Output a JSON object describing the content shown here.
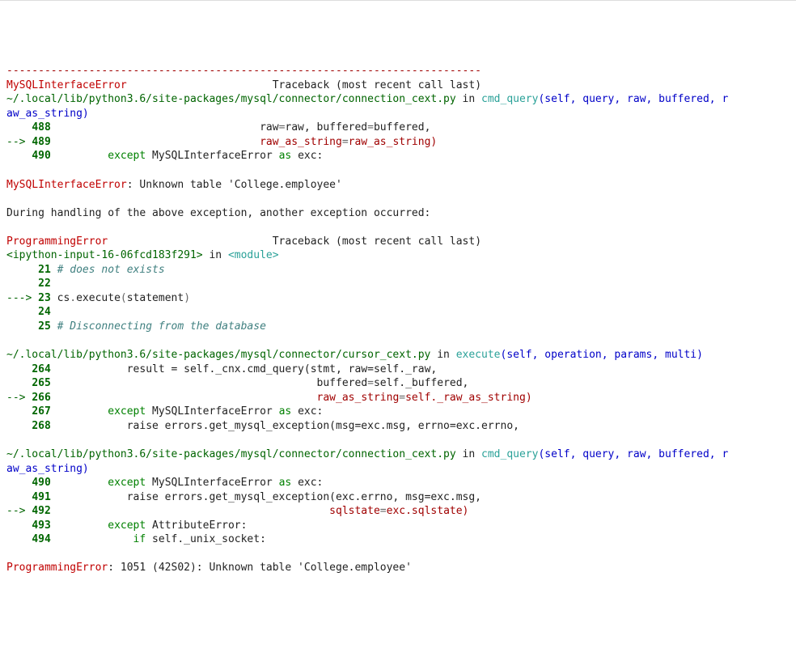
{
  "divider": "---------------------------------------------------------------------------",
  "tb_label": "Traceback (most recent call last)",
  "errs": {
    "mysql_iface": "MySQLInterfaceError",
    "prog": "ProgrammingError"
  },
  "msg": {
    "unknown_table": ": Unknown table 'College.employee'",
    "during": "During handling of the above exception, another exception occurred:",
    "prog_final": ": 1051 (42S02): Unknown table 'College.employee'"
  },
  "paths": {
    "conn": "~/.local/lib/python3.6/site-packages/mysql/connector/connection_cext.py",
    "cursor": "~/.local/lib/python3.6/site-packages/mysql/connector/cursor_cext.py",
    "ipy": "<ipython-input-16-06fcd183f291>"
  },
  "kw": {
    "in": "in",
    "as": "as",
    "except": "except",
    "if": "if",
    "raise": "raise"
  },
  "fn": {
    "cmd_query": "cmd_query",
    "execute": "execute",
    "module": "<module>"
  },
  "sig": {
    "cmd_query_head": "(self, query, raw, buffered, r",
    "cmd_query_tail": "aw_as_string)",
    "execute_args": "(self, operation, params, multi)"
  },
  "frame1": {
    "n488": "488",
    "l488a": "raw",
    "l488b": "raw, buffered",
    "l488c": "buffered,",
    "arrow489": "--> ",
    "n489": "489",
    "l489a": "raw_as_string",
    "l489b": "raw_as_string)",
    "n490": "490",
    "l490a": "MySQLInterfaceError",
    "l490b": "exc:"
  },
  "frame_ipy": {
    "n21": "21",
    "c21": "# does not exists",
    "n22": "22",
    "arrow23": "---> ",
    "n23": "23",
    "l23a": "cs",
    "l23b": "execute",
    "l23c": "statement",
    "n24": "24",
    "n25": "25",
    "c25": "# Disconnecting from the database"
  },
  "frame_cur": {
    "n264": "264",
    "l264": "            result = self._cnx.cmd_query(stmt, raw=self._raw,",
    "n265": "265",
    "l265a": "buffered",
    "l265b": "self._buffered,",
    "arrow266": "--> ",
    "n266": "266",
    "l266a": "raw_as_string",
    "l266b": "self._raw_as_string)",
    "n267": "267",
    "l267a": "MySQLInterfaceError",
    "l267b": "exc:",
    "n268": "268",
    "l268": "            raise errors.get_mysql_exception(msg=exc.msg, errno=exc.errno,"
  },
  "frame_conn2": {
    "n490": "490",
    "l490a": "MySQLInterfaceError",
    "l490b": "exc:",
    "n491": "491",
    "l491": "            raise errors.get_mysql_exception(exc.errno, msg=exc.msg,",
    "arrow492": "--> ",
    "n492": "492",
    "l492": "sqlstate",
    "l492b": "exc.sqlstate)",
    "n493": "493",
    "l493": "AttributeError:",
    "n494": "494",
    "l494": "self._unix_socket:"
  }
}
